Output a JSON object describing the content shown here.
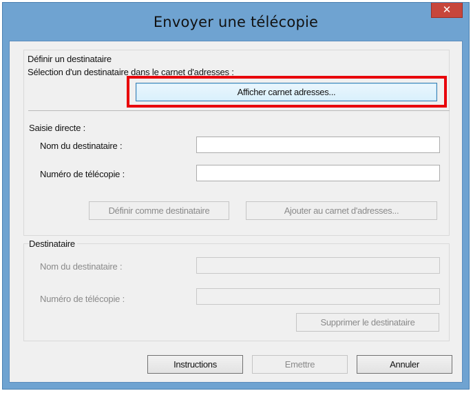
{
  "window": {
    "title": "Envoyer une télécopie",
    "close_glyph": "✕"
  },
  "define_group": {
    "title": "Définir un destinataire",
    "addressbook_prompt": "Sélection d'un destinataire dans le carnet d'adresses :",
    "show_addressbook_label": "Afficher carnet adresses..."
  },
  "direct_entry": {
    "title": "Saisie directe :",
    "name_label": "Nom du destinataire :",
    "name_value": "",
    "fax_label": "Numéro de télécopie :",
    "fax_value": "",
    "set_recipient_label": "Définir comme destinataire",
    "add_to_addressbook_label": "Ajouter au carnet d'adresses..."
  },
  "recipient_group": {
    "title": "Destinataire",
    "name_label": "Nom du destinataire :",
    "name_value": "",
    "fax_label": "Numéro de télécopie :",
    "fax_value": "",
    "delete_label": "Supprimer le destinataire"
  },
  "footer": {
    "instructions_label": "Instructions",
    "send_label": "Emettre",
    "cancel_label": "Annuler"
  },
  "colors": {
    "window_frame": "#6fa3d1",
    "close_button": "#c7463b",
    "highlight_box": "#e8000a",
    "dialog_background": "#f0f0f0"
  }
}
